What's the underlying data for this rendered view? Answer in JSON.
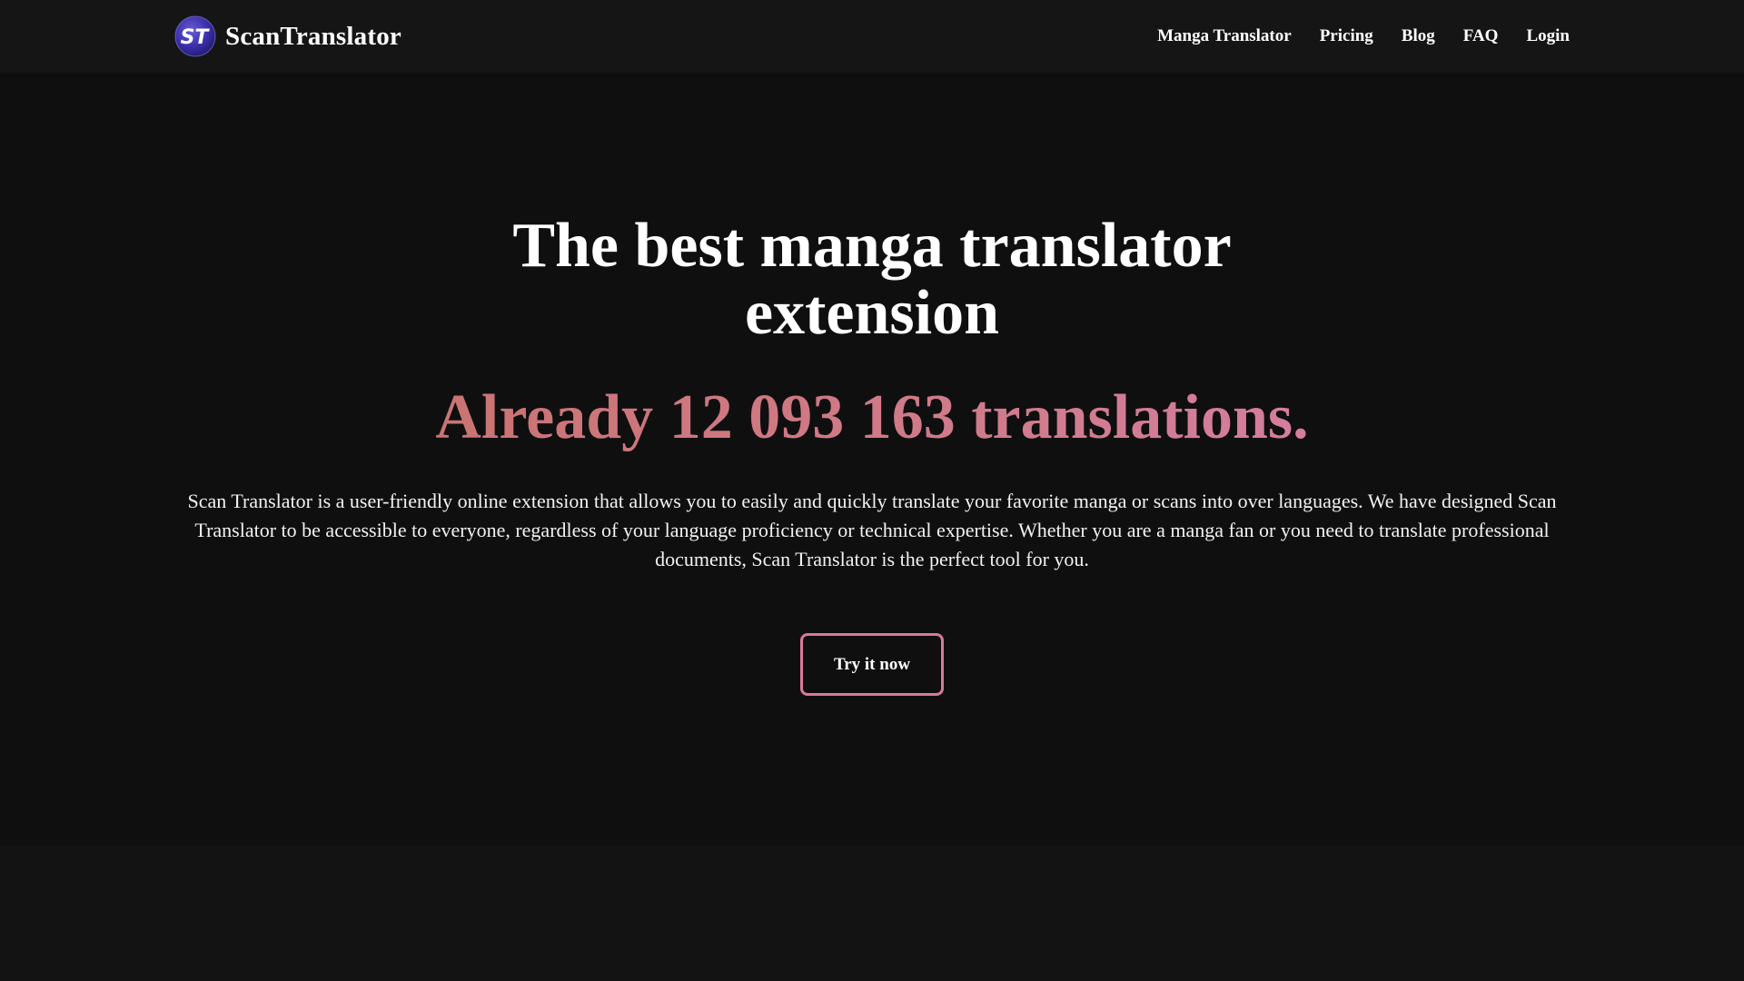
{
  "header": {
    "brand": {
      "name": "ScanTranslator",
      "logo_text": "ST",
      "logo_icon": "st-logo-icon"
    },
    "nav": {
      "items": [
        {
          "label": "Manga Translator"
        },
        {
          "label": "Pricing"
        },
        {
          "label": "Blog"
        },
        {
          "label": "FAQ"
        },
        {
          "label": "Login"
        }
      ]
    }
  },
  "hero": {
    "title": "The best manga translator extension",
    "counter_prefix": "Already",
    "counter_value": "12 093 163",
    "counter_suffix": "translations.",
    "description": "Scan Translator is a user-friendly online extension that allows you to easily and quickly translate your favorite manga or scans into over languages. We have designed Scan Translator to be accessible to everyone, regardless of your language proficiency or technical expertise. Whether you are a manga fan or you need to translate professional documents, Scan Translator is the perfect tool for you.",
    "cta_label": "Try it now"
  },
  "colors": {
    "background": "#0f0f10",
    "header_background": "#151516",
    "text": "#ffffff",
    "accent_gradient_start": "#c8706a",
    "accent_gradient_end": "#d67fa8",
    "cta_border": "#d9799c",
    "logo_blue": "#3b2fa8"
  }
}
